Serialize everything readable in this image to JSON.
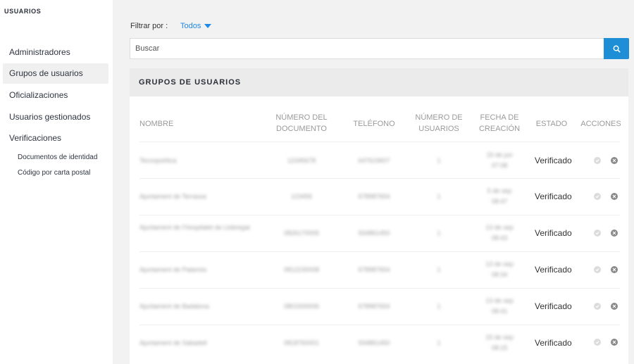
{
  "sidebar": {
    "title": "USUARIOS",
    "items": [
      {
        "label": "Administradores"
      },
      {
        "label": "Grupos de usuarios"
      },
      {
        "label": "Oficializaciones"
      },
      {
        "label": "Usuarios gestionados"
      },
      {
        "label": "Verificaciones"
      }
    ],
    "subitems": [
      {
        "label": "Documentos de identidad"
      },
      {
        "label": "Código por carta postal"
      }
    ]
  },
  "filter": {
    "label": "Filtrar por :",
    "value": "Todos"
  },
  "search": {
    "placeholder": "Buscar",
    "icon": "search-icon"
  },
  "table": {
    "title": "GRUPOS DE USUARIOS",
    "columns": {
      "name": "NOMBRE",
      "doc_number": "NÚMERO DEL DOCUMENTO",
      "phone": "TELÉFONO",
      "user_count": "NÚMERO DE USUARIOS",
      "created": "FECHA DE CREACIÓN",
      "status": "ESTADO",
      "actions": "ACCIONES"
    },
    "rows": [
      {
        "name": "Tecnopolítica",
        "doc": "12345678",
        "phone": "647619607",
        "users": "1",
        "date1": "15 de jun",
        "date2": "07:08",
        "status": "Verificado"
      },
      {
        "name": "Ajuntament de Terrassa",
        "doc": "123456",
        "phone": "678987654",
        "users": "1",
        "date1": "5 de sep",
        "date2": "08:47",
        "status": "Verificado"
      },
      {
        "name": "Ajuntament de l'Hospitalet de Llobregat",
        "doc": "0826170005",
        "phone": "934861450",
        "users": "1",
        "date1": "13 de sep",
        "date2": "08:43",
        "status": "Verificado"
      },
      {
        "name": "Ajuntament de Palamós",
        "doc": "0812230008",
        "phone": "678987654",
        "users": "1",
        "date1": "13 de sep",
        "date2": "08:34",
        "status": "Verificado"
      },
      {
        "name": "Ajuntament de Badalona",
        "doc": "0801500006",
        "phone": "678987654",
        "users": "1",
        "date1": "13 de sep",
        "date2": "08:41",
        "status": "Verificado"
      },
      {
        "name": "Ajuntament de Sabadell",
        "doc": "0818760001",
        "phone": "934861450",
        "users": "1",
        "date1": "15 de sep",
        "date2": "08:15",
        "status": "Verificado"
      }
    ]
  },
  "colors": {
    "accent": "#1e88e5",
    "search_button": "#1e8fd6"
  }
}
